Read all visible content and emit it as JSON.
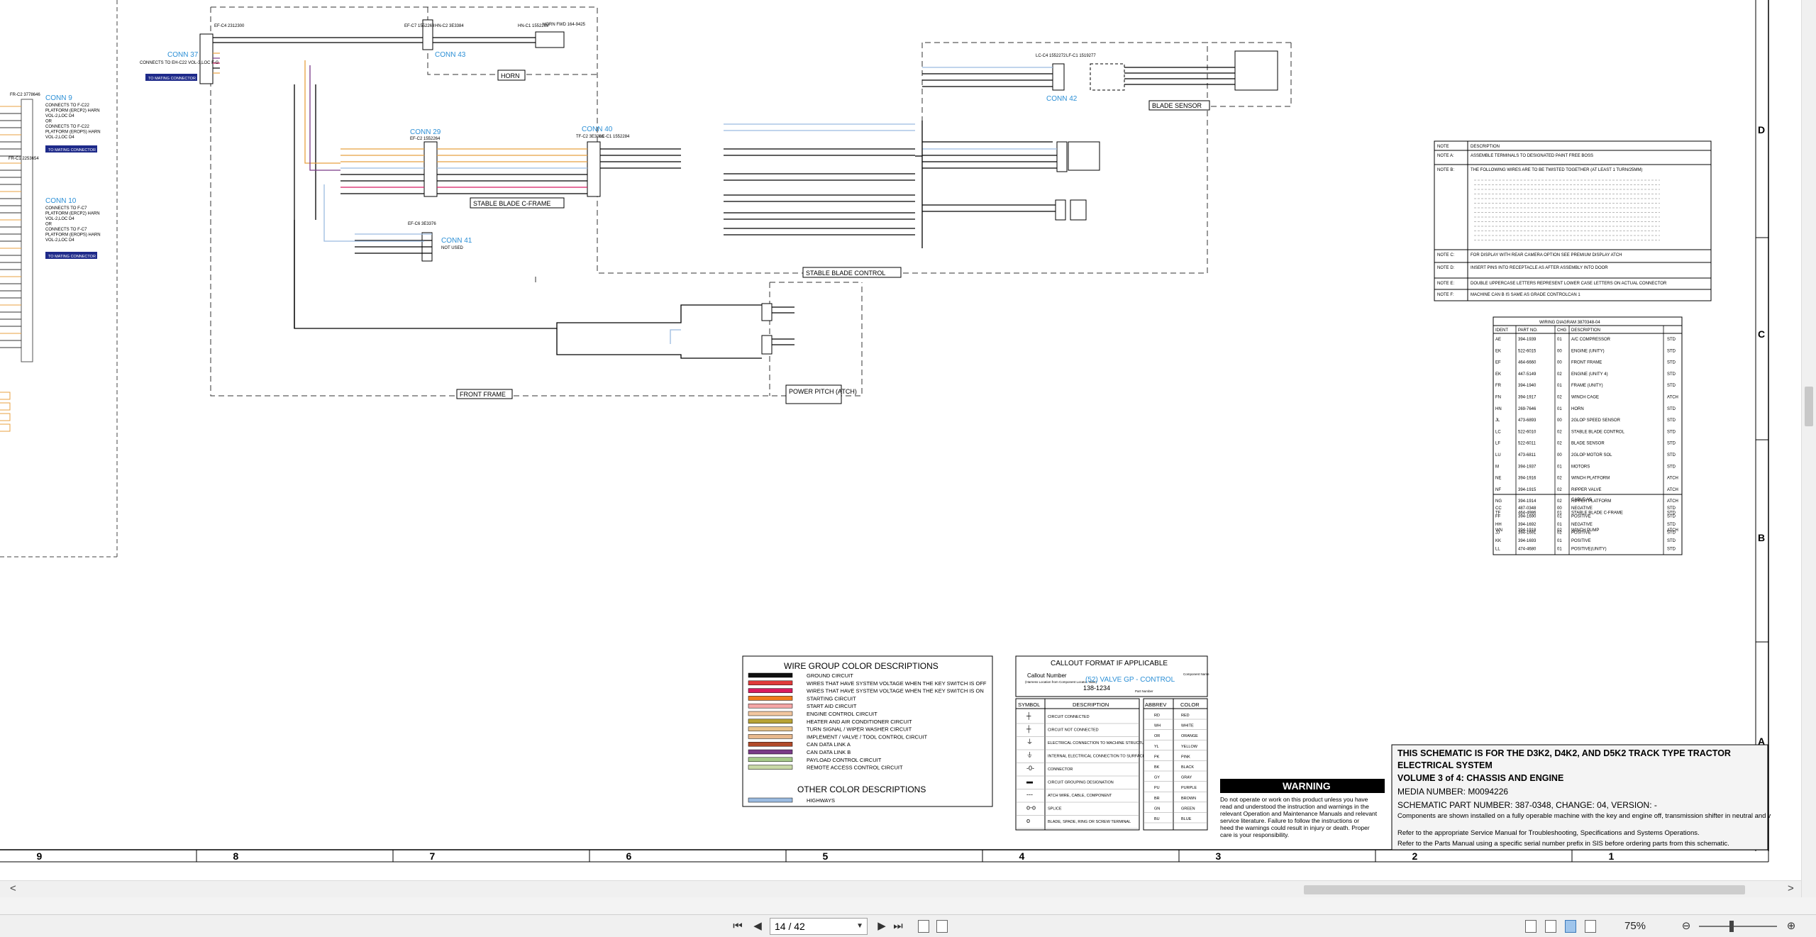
{
  "toolbar": {
    "page_value": "14 / 42",
    "zoom": "75%",
    "first_page": "⏮",
    "prev_page": "◀",
    "next_page": "▶",
    "last_page": "⏭",
    "zoom_out": "⊖",
    "zoom_in": "⊕"
  },
  "scroll": {
    "left_arrow": "<",
    "right_arrow": ">"
  },
  "frame": {
    "columns": [
      "9",
      "8",
      "7",
      "6",
      "5",
      "4",
      "3",
      "2",
      "1"
    ],
    "rows": [
      "D",
      "C",
      "B",
      "A"
    ]
  },
  "left_conns": [
    {
      "title": "CONN 9",
      "ref": "FR-C2\n3778646",
      "lines": [
        "CONNECTS TO F-C22",
        "PLATFORM (ERCP2) HARN",
        "VOL-2,LOC D4",
        "OR",
        "CONNECTS TO F-C22",
        "PLATFORM (EROPS) HARN",
        "VOL-2,LOC D4"
      ],
      "tag": "TO MATING CONNECTOR"
    },
    {
      "title": "CONN 10",
      "ref": "FR-C1\n2253654",
      "lines": [
        "CONNECTS TO F-C7",
        "PLATFORM (ERCP2) HARN",
        "VOL-2,LOC D4",
        "OR",
        "CONNECTS TO F-C7",
        "PLATFORM (EROPS) HARN",
        "VOL-2,LOC D4"
      ],
      "tag": "TO MATING CONNECTOR"
    }
  ],
  "connectors": {
    "conn37": {
      "title": "CONN 37",
      "ref": "EF-C4\n2312300",
      "note": "CONNECTS TO EH-C22\nVOL-3,LOC F-G",
      "tag": "TO MATING CONNECTOR"
    },
    "conn43": {
      "title": "CONN 43",
      "ref": "EF-C7\n1552269",
      "ref2": "HN-C2\n3E3384",
      "ref3": "HN-C1\n1552269"
    },
    "horn": {
      "label": "HORN",
      "sub": "HORN FWD\n164-9425"
    },
    "conn29": {
      "title": "CONN 29",
      "ref": "EF-C2\n1552264"
    },
    "conn40": {
      "title": "CONN 40",
      "ref": "TF-C2\n3E3386",
      "ref2": "LC-C1\n1552284"
    },
    "conn41": {
      "title": "CONN 41",
      "note": "NOT USED",
      "ref": "EF-C6\n3E3376"
    },
    "conn42": {
      "title": "CONN 42",
      "ref": "LC-C4\n1552272",
      "ref2": "LF-C1\n1519277"
    },
    "blade_sensor": "BLADE SENSOR",
    "stable_blade_cframe": "STABLE BLADE C-FRAME",
    "stable_blade_control": "STABLE BLADE CONTROL",
    "front_frame": "FRONT FRAME",
    "power_pitch": "POWER PITCH\n(ATCH)"
  },
  "notes": {
    "header": [
      "NOTE",
      "DESCRIPTION"
    ],
    "rows": [
      [
        "NOTE A:",
        "ASSEMBLE TERMINALS TO DESIGNATED PAINT FREE BOSS"
      ],
      [
        "NOTE B:",
        "THE FOLLOWING WIRES ARE TO BE TWISTED TOGETHER (AT LEAST 1 TURN/25MM)"
      ],
      [
        "NOTE C:",
        "FOR DISPLAY WITH REAR CAMERA OPTION SEE PREMIUM DISPLAY ATCH"
      ],
      [
        "NOTE D:",
        "INSERT PINS INTO RECEPTACLE AS AFTER ASSEMBLY INTO DOOR"
      ],
      [
        "NOTE E:",
        "DOUBLE UPPERCASE LETTERS REPRESENT LOWER CASE LETTERS ON ACTUAL CONNECTOR"
      ],
      [
        "NOTE F:",
        "MACHINE CAN B IS SAME AS GRADE CONTROLCAN 1"
      ]
    ]
  },
  "wiring_table": {
    "title": "WIRING DIAGRAM 3870348-04",
    "header": [
      "IDENT",
      "PART NO.",
      "CHG",
      "DESCRIPTION",
      ""
    ],
    "rows": [
      [
        "AE",
        "394-1939",
        "01",
        "A/C COMPRESSOR",
        "STD"
      ],
      [
        "EK",
        "522-6015",
        "00",
        "ENGINE (UNITY)",
        "STD"
      ],
      [
        "EF",
        "464-6660",
        "00",
        "FRONT FRAME",
        "STD"
      ],
      [
        "EK",
        "447-5149",
        "02",
        "ENGINE (UNITY 4)",
        "STD"
      ],
      [
        "FR",
        "394-1940",
        "01",
        "FRAME (UNITY)",
        "STD"
      ],
      [
        "FN",
        "394-1917",
        "02",
        "WINCH CAGE",
        "ATCH"
      ],
      [
        "HN",
        "269-7646",
        "01",
        "HORN",
        "STD"
      ],
      [
        "JL",
        "473-6893",
        "00",
        "2GLOP SPEED SENSOR",
        "STD"
      ],
      [
        "LC",
        "522-6010",
        "02",
        "STABLE BLADE CONTROL",
        "STD"
      ],
      [
        "LF",
        "522-6011",
        "02",
        "BLADE SENSOR",
        "STD"
      ],
      [
        "LU",
        "473-6811",
        "00",
        "2GLOP MOTOR SOL",
        "STD"
      ],
      [
        "M",
        "394-1937",
        "01",
        "MOTORS",
        "STD"
      ],
      [
        "NE",
        "394-1916",
        "02",
        "WINCH PLATFORM",
        "ATCH"
      ],
      [
        "NF",
        "394-1915",
        "02",
        "RIPPER VALVE",
        "ATCH"
      ],
      [
        "NG",
        "394-1914",
        "02",
        "RIPPER PLATFORM",
        "ATCH"
      ],
      [
        "TF",
        "464-4986",
        "01",
        "STABLE BLADE C-FRAME",
        "STD"
      ],
      [
        "WN",
        "394-1918",
        "02",
        "WINCH PUMP",
        "ATCH"
      ]
    ],
    "cable_header": "CABLE AS.",
    "cable_rows": [
      [
        "CC",
        "487-0348",
        "00",
        "NEGATIVE",
        "STD"
      ],
      [
        "FF",
        "394-1690",
        "01",
        "POSITIVE",
        "STD"
      ],
      [
        "HH",
        "394-1692",
        "01",
        "NEGATIVE",
        "STD"
      ],
      [
        "JJ",
        "394-1691",
        "02",
        "POSITIVE",
        "STD"
      ],
      [
        "KK",
        "394-1693",
        "01",
        "POSITIVE",
        "STD"
      ],
      [
        "LL",
        "474-4680",
        "01",
        "POSITIVE(UNITY)",
        "STD"
      ]
    ]
  },
  "wire_colors": {
    "title": "WIRE GROUP COLOR DESCRIPTIONS",
    "items": [
      {
        "label": "GROUND CIRCUIT",
        "color": "#111111"
      },
      {
        "label": "WIRES THAT HAVE SYSTEM VOLTAGE WHEN THE KEY SWITCH IS OFF",
        "color": "#e03a3a"
      },
      {
        "label": "WIRES THAT HAVE SYSTEM VOLTAGE WHEN THE KEY SWITCH IS ON",
        "color": "#d81b60"
      },
      {
        "label": "STARTING CIRCUIT",
        "color": "#f07c1e"
      },
      {
        "label": "START AID CIRCUIT",
        "color": "#f4a6a6"
      },
      {
        "label": "ENGINE CONTROL CIRCUIT",
        "color": "#f2c7a0"
      },
      {
        "label": "HEATER AND AIR CONDITIONER CIRCUIT",
        "color": "#b8a334"
      },
      {
        "label": "TURN SIGNAL / WIPER WASHER CIRCUIT",
        "color": "#e9c38a"
      },
      {
        "label": "IMPLEMENT / VALVE / TOOL CONTROL CIRCUIT",
        "color": "#e8b98e"
      },
      {
        "label": "CAN DATA LINK A",
        "color": "#b24a2a"
      },
      {
        "label": "CAN DATA LINK B",
        "color": "#7a3a88"
      },
      {
        "label": "PAYLOAD CONTROL CIRCUIT",
        "color": "#a6c98a"
      },
      {
        "label": "REMOTE ACCESS CONTROL CIRCUIT",
        "color": "#c8d8a6"
      }
    ],
    "other_title": "OTHER COLOR DESCRIPTIONS",
    "other_items": [
      {
        "label": "HIGHWAYS",
        "color": "#9bbbe0"
      }
    ]
  },
  "callout": {
    "title": "CALLOUT FORMAT IF APPLICABLE",
    "callout_number": "Callout Number",
    "callout_sub": "(Harness Location from\nComponent Locator Table)",
    "link_text": "(52) VALVE GP - CONTROL",
    "part_no": "138-1234",
    "component_name": "Component\nName",
    "part_number_label": "Part Number"
  },
  "symbols": {
    "header": [
      "SYMBOL",
      "DESCRIPTION"
    ],
    "rows": [
      [
        "┼",
        "CIRCUIT CONNECTED"
      ],
      [
        "┼",
        "CIRCUIT NOT CONNECTED"
      ],
      [
        "⏚",
        "ELECTRICAL CONNECTION TO MACHINE STRUCTURE"
      ],
      [
        "⏚",
        "INTERNAL ELECTRICAL CONNECTION TO SURFACE OF COMPONENT"
      ],
      [
        "-0-",
        "CONNECTOR"
      ],
      [
        "▬",
        "CIRCUIT GROUPING DESIGNATION"
      ],
      [
        "---",
        "ATCH WIRE, CABLE, COMPONENT"
      ],
      [
        "o-o",
        "SPLICE"
      ],
      [
        "o",
        "BLADE, SPADE, RING OR SCREW TERMINAL"
      ]
    ]
  },
  "abbrev": {
    "header": [
      "ABBREV",
      "COLOR"
    ],
    "rows": [
      [
        "RD",
        "RED"
      ],
      [
        "WH",
        "WHITE"
      ],
      [
        "OR",
        "ORANGE"
      ],
      [
        "YL",
        "YELLOW"
      ],
      [
        "PK",
        "PINK"
      ],
      [
        "BK",
        "BLACK"
      ],
      [
        "GY",
        "GRAY"
      ],
      [
        "PU",
        "PURPLE"
      ],
      [
        "BR",
        "BROWN"
      ],
      [
        "GN",
        "GREEN"
      ],
      [
        "BU",
        "BLUE"
      ]
    ]
  },
  "warning": {
    "title": "WARNING",
    "text": "Do not operate or work on this product unless you have read and understood the instruction and warnings in the relevant Operation and Maintenance Manuals and relevant service literature. Failure to follow the instructions or heed the warnings could result in injury or death. Proper care is your responsibility."
  },
  "title_block": {
    "line1": "THIS SCHEMATIC IS FOR THE D3K2, D4K2, AND D5K2 TRACK TYPE TRACTOR",
    "line2": "ELECTRICAL SYSTEM",
    "line3": "VOLUME 3 of 4: CHASSIS AND ENGINE",
    "line4": "MEDIA NUMBER: M0094226",
    "line5": "SCHEMATIC PART NUMBER: 387-0348, CHANGE: 04, VERSION: -",
    "line6": "Components are shown installed on a fully operable machine with the key and engine off, transmission shifter in neutral and with parking brake set.",
    "line7": "Refer to the appropriate Service Manual for Troubleshooting, Specifications and Systems Operations.",
    "line8": "Refer to the Parts Manual using a specific serial number prefix in SIS before ordering parts from this schematic."
  }
}
